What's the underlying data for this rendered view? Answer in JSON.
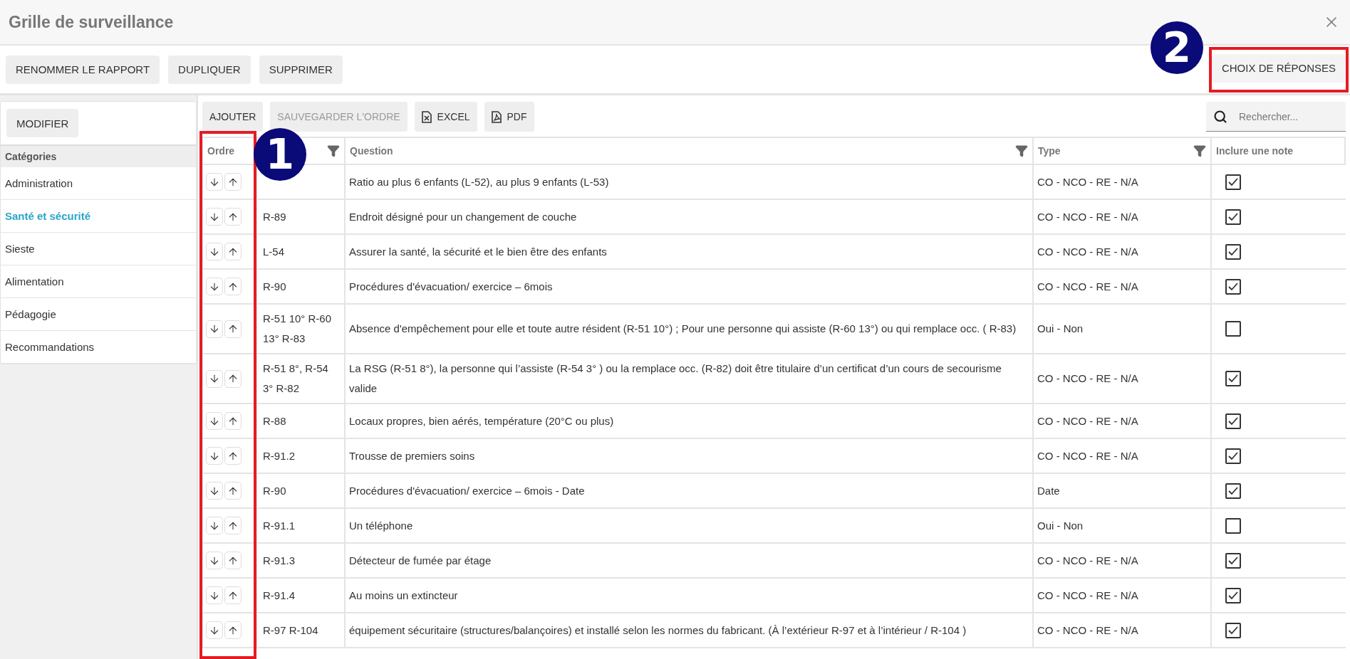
{
  "window": {
    "title": "Grille de surveillance"
  },
  "toolbar": {
    "buttons": [
      "RENOMMER LE RAPPORT",
      "DUPLIQUER",
      "SUPPRIMER"
    ],
    "right_button": "CHOIX DE RÉPONSES"
  },
  "sidebar": {
    "button": "MODIFIER",
    "header": "Catégories",
    "items": [
      {
        "label": "Administration",
        "selected": false
      },
      {
        "label": "Santé et sécurité",
        "selected": true
      },
      {
        "label": "Sieste",
        "selected": false
      },
      {
        "label": "Alimentation",
        "selected": false
      },
      {
        "label": "Pédagogie",
        "selected": false
      },
      {
        "label": "Recommandations",
        "selected": false
      }
    ]
  },
  "table_toolbar": {
    "buttons": [
      {
        "kind": "text",
        "label": "AJOUTER",
        "disabled": false
      },
      {
        "kind": "text",
        "label": "SAUVEGARDER L'ORDRE",
        "disabled": true
      },
      {
        "kind": "excel",
        "label": "EXCEL",
        "disabled": false
      },
      {
        "kind": "pdf",
        "label": "PDF",
        "disabled": false
      }
    ],
    "search": {
      "placeholder": "Rechercher..."
    }
  },
  "table": {
    "columns": [
      {
        "label": "Ordre",
        "filter": false
      },
      {
        "filter": true
      },
      {
        "label": "Question",
        "filter": true
      },
      {
        "label": "Type",
        "filter": true
      },
      {
        "label": "Inclure une note",
        "filter": false
      }
    ],
    "rows": [
      {
        "question": "Ratio au plus 6 enfants (L-52), au plus 9 enfants (L-53)",
        "type": "CO - NCO - RE - N/A",
        "include_note": true
      },
      {
        "code": "R-89",
        "question": "Endroit désigné pour un changement de couche",
        "type": "CO - NCO - RE - N/A",
        "include_note": true
      },
      {
        "code": "L-54",
        "question": "Assurer la santé, la sécurité et le bien être des enfants",
        "type": "CO - NCO - RE - N/A",
        "include_note": true
      },
      {
        "code": "R-90",
        "question": "Procédures d'évacuation/ exercice – 6mois",
        "type": "CO - NCO - RE - N/A",
        "include_note": true
      },
      {
        "code": "R-51 10° R-60 13° R-83",
        "question": "Absence d'empêchement pour elle et toute autre résident (R-51 10°) ; Pour une personne qui assiste (R-60 13°) ou qui remplace occ. ( R-83)",
        "type": "Oui - Non",
        "include_note": false
      },
      {
        "code": "R-51 8°, R-54 3° R-82",
        "question": "La RSG (R-51 8°), la personne qui l’assiste (R-54 3° ) ou la remplace occ. (R-82) doit être titulaire d’un certificat d’un cours de secourisme valide",
        "type": "CO - NCO - RE - N/A",
        "include_note": true
      },
      {
        "code": "R-88",
        "question": "Locaux propres, bien aérés, température (20°C ou plus)",
        "type": "CO - NCO - RE - N/A",
        "include_note": true
      },
      {
        "code": "R-91.2",
        "question": "Trousse de premiers soins",
        "type": "CO - NCO - RE - N/A",
        "include_note": true
      },
      {
        "code": "R-90",
        "question": "Procédures d'évacuation/ exercice – 6mois - Date",
        "type": "Date",
        "include_note": true
      },
      {
        "code": "R-91.1",
        "question": "Un téléphone",
        "type": "Oui - Non",
        "include_note": false
      },
      {
        "code": "R-91.3",
        "question": "Détecteur de fumée par étage",
        "type": "CO - NCO - RE - N/A",
        "include_note": true
      },
      {
        "code": "R-91.4",
        "question": "Au moins un extincteur",
        "type": "CO - NCO - RE - N/A",
        "include_note": true
      },
      {
        "code": "R-97 R-104",
        "question": "équipement sécuritaire (structures/balançoires) et installé selon les normes du fabricant. (À l’extérieur R-97 et à l’intérieur / R-104 )",
        "type": "CO - NCO - RE - N/A",
        "include_note": true
      }
    ]
  },
  "annotations": [
    {
      "label": "1"
    },
    {
      "label": "2"
    }
  ]
}
